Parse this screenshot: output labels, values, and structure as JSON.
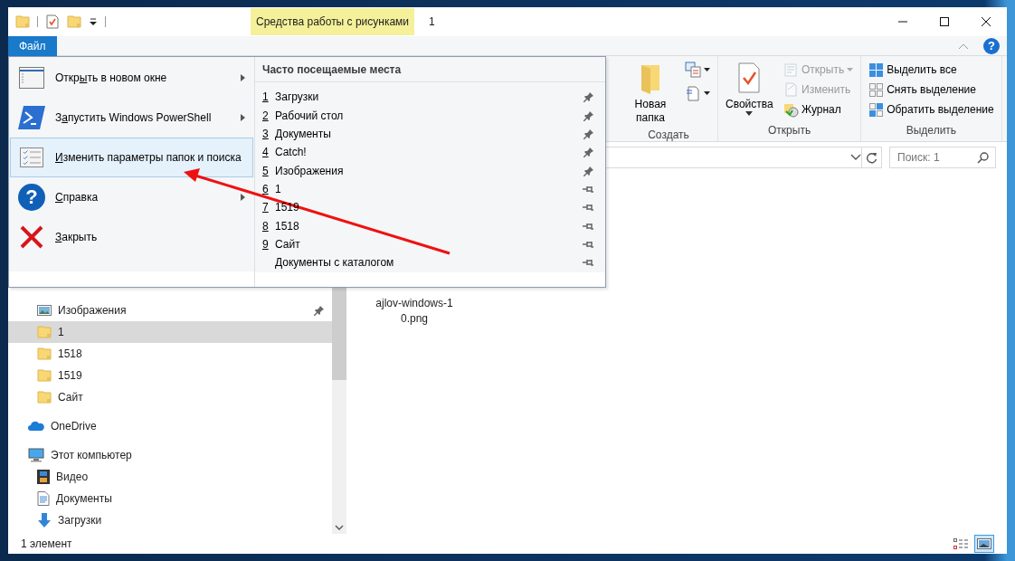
{
  "title_bar": {
    "context_tab": "Средства работы с рисунками",
    "title": "1"
  },
  "ribbon_tabs": [
    {
      "label": "Файл",
      "selected": true
    }
  ],
  "help_button": {
    "glyph": "?"
  },
  "ribbon_groups": [
    {
      "label": "Создать",
      "buttons": [
        {
          "kind": "large",
          "label": "Новая папка"
        },
        {
          "kind": "icon-stack"
        }
      ]
    },
    {
      "label": "Открыть",
      "buttons": [
        {
          "kind": "large",
          "label": "Свойства",
          "dropdown": true
        },
        {
          "kind": "small-stack",
          "items": [
            {
              "label": "Открыть",
              "disabled": true,
              "dropdown": true
            },
            {
              "label": "Изменить",
              "disabled": true,
              "dropdown": false
            },
            {
              "label": "Журнал",
              "disabled": false,
              "dropdown": false
            }
          ]
        }
      ]
    },
    {
      "label": "Выделить",
      "buttons": [
        {
          "kind": "small-stack",
          "items": [
            {
              "label": "Выделить все",
              "disabled": false,
              "dropdown": false
            },
            {
              "label": "Снять выделение",
              "disabled": false,
              "dropdown": false
            },
            {
              "label": "Обратить выделение",
              "disabled": false,
              "dropdown": false
            }
          ]
        }
      ]
    }
  ],
  "search": {
    "placeholder": "Поиск: 1"
  },
  "file_menu": {
    "commands": [
      {
        "label_parts": [
          {
            "text": "Откр",
            "underlined": false
          },
          {
            "text": "ы",
            "underlined": true
          },
          {
            "text": "ть в новом окне",
            "underlined": false
          }
        ],
        "submenu": true,
        "selected": false
      },
      {
        "label_parts": [
          {
            "text": "З",
            "underlined": false
          },
          {
            "text": "а",
            "underlined": true
          },
          {
            "text": "пустить Windows PowerShell",
            "underlined": false
          }
        ],
        "submenu": true,
        "selected": false
      },
      {
        "label_parts": [
          {
            "text": "И",
            "underlined": true
          },
          {
            "text": "зменить параметры папок и поиска",
            "underlined": false
          }
        ],
        "submenu": false,
        "selected": true
      },
      {
        "label_parts": [
          {
            "text": "С",
            "underlined": true
          },
          {
            "text": "правка",
            "underlined": false
          }
        ],
        "icon_glyph": "?",
        "submenu": true,
        "selected": false
      },
      {
        "label_parts": [
          {
            "text": "З",
            "underlined": true
          },
          {
            "text": "акрыть",
            "underlined": false
          }
        ],
        "submenu": false,
        "selected": false
      }
    ],
    "frequent_heading": "Часто посещаемые места",
    "frequent": [
      {
        "number": "1",
        "label": "Загрузки",
        "pinned": true
      },
      {
        "number": "2",
        "label": "Рабочий стол",
        "pinned": true
      },
      {
        "number": "3",
        "label": "Документы",
        "pinned": true
      },
      {
        "number": "4",
        "label": "Catch!",
        "pinned": true
      },
      {
        "number": "5",
        "label": "Изображения",
        "pinned": true
      },
      {
        "number": "6",
        "label": "1",
        "pinned": false
      },
      {
        "number": "7",
        "label": "1519",
        "pinned": false
      },
      {
        "number": "8",
        "label": "1518",
        "pinned": false
      },
      {
        "number": "9",
        "label": "Сайт",
        "pinned": false
      },
      {
        "label": "Документы с каталогом",
        "pinned": false
      }
    ]
  },
  "nav_quick_access": [
    {
      "kind": "library",
      "label": "Изображения",
      "pinned": true,
      "selected": false
    },
    {
      "kind": "folder",
      "label": "1",
      "pinned": false,
      "selected": true
    },
    {
      "kind": "folder",
      "label": "1518",
      "pinned": false,
      "selected": false
    },
    {
      "kind": "folder",
      "label": "1519",
      "pinned": false,
      "selected": false
    },
    {
      "kind": "folder",
      "label": "Сайт",
      "pinned": false,
      "selected": false
    }
  ],
  "nav_roots": [
    {
      "kind": "cloud",
      "label": "OneDrive",
      "selected": false
    },
    {
      "kind": "computer",
      "label": "Этот компьютер",
      "selected": false,
      "children": [
        {
          "kind": "video",
          "label": "Видео",
          "selected": false
        },
        {
          "kind": "document",
          "label": "Документы",
          "selected": false
        },
        {
          "kind": "download",
          "label": "Загрузки",
          "selected": false
        }
      ]
    }
  ],
  "file": {
    "name_lines": [
      "ajlov-windows-1",
      "0.png"
    ]
  },
  "status_bar": {
    "text": "1 элемент",
    "views": [
      {
        "kind": "details",
        "selected": false
      },
      {
        "kind": "large-icons",
        "selected": true
      }
    ]
  }
}
